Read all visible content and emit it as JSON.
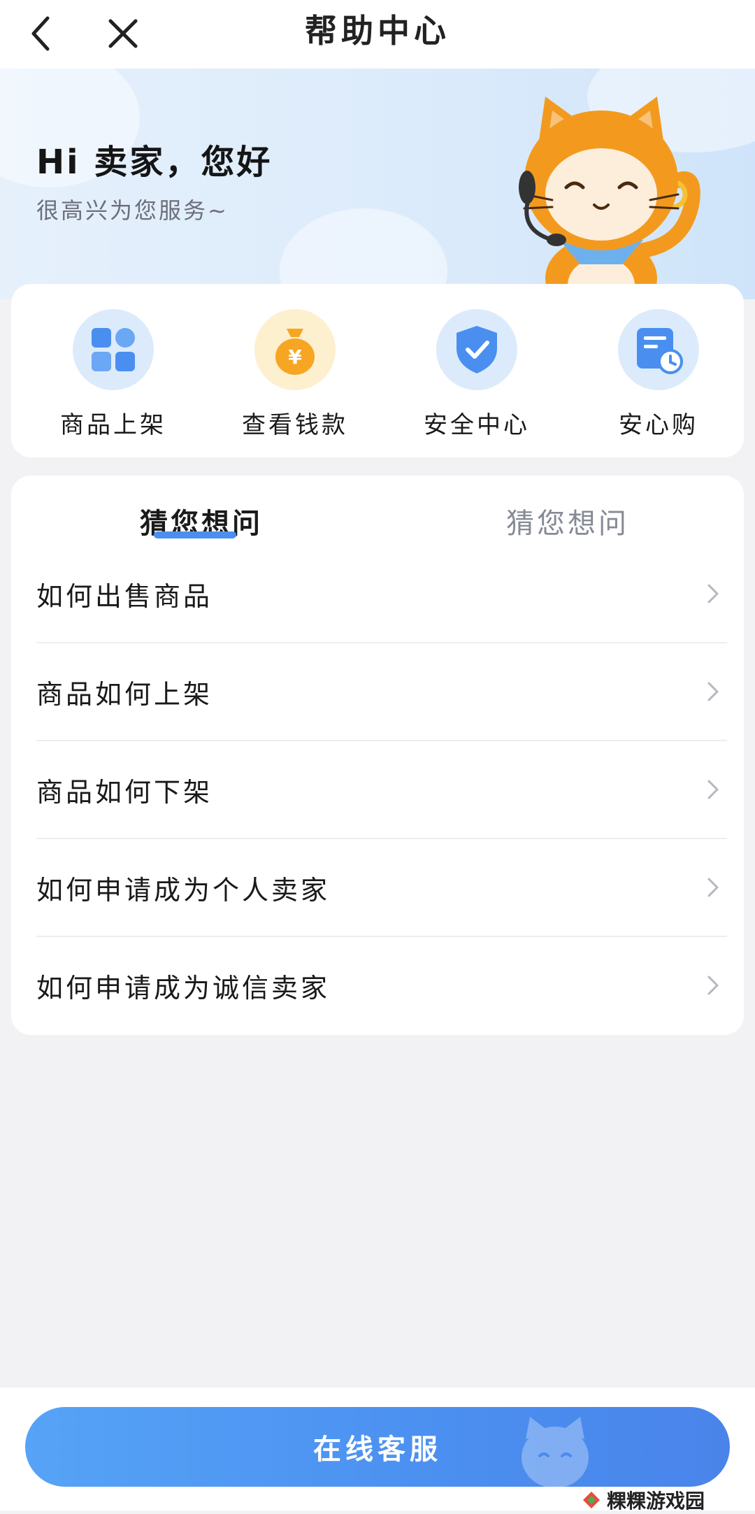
{
  "header": {
    "title": "帮助中心"
  },
  "hero": {
    "greeting": "Hi 卖家，您好",
    "subtitle": "很高兴为您服务~"
  },
  "quick_entries": [
    {
      "label": "商品上架",
      "icon": "grid-apps-icon",
      "color": "#4a8ff0"
    },
    {
      "label": "查看钱款",
      "icon": "money-bag-icon",
      "color": "#f6a623"
    },
    {
      "label": "安全中心",
      "icon": "shield-check-icon",
      "color": "#4a8ff0"
    },
    {
      "label": "安心购",
      "icon": "calendar-clock-icon",
      "color": "#4a8ff0"
    }
  ],
  "tabs": {
    "active": "猜您想问",
    "inactive": "猜您想问"
  },
  "faq": [
    "如何出售商品",
    "商品如何上架",
    "商品如何下架",
    "如何申请成为个人卖家",
    "如何申请成为诚信卖家"
  ],
  "bottom": {
    "service_button": "在线客服"
  },
  "watermark": {
    "text": "粿粿游戏园"
  },
  "colors": {
    "accent": "#4a8ff0",
    "mascot_orange": "#f39a1e",
    "background": "#f2f2f4"
  }
}
